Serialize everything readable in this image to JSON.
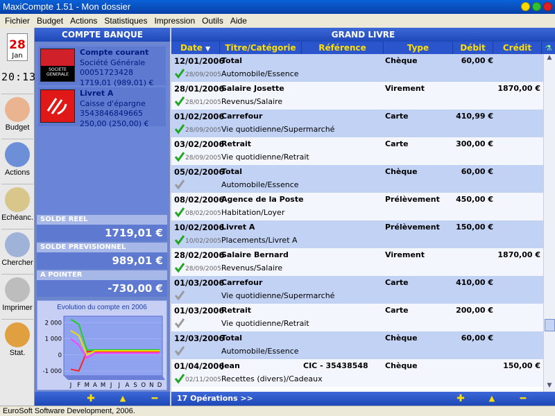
{
  "window": {
    "title": "MaxiCompte 1.51 - Mon dossier"
  },
  "menu": [
    "Fichier",
    "Budget",
    "Actions",
    "Statistiques",
    "Impression",
    "Outils",
    "Aide"
  ],
  "calendar": {
    "day": "28",
    "month": "Jan",
    "time": "20:13"
  },
  "tools": [
    {
      "label": "Budget",
      "icon": "piggy-bank-icon",
      "color": "#e9b48f"
    },
    {
      "label": "Actions",
      "icon": "gears-icon",
      "color": "#6d8fd8"
    },
    {
      "label": "Echéanc.",
      "icon": "clock-icon",
      "color": "#d9c68a"
    },
    {
      "label": "Chercher",
      "icon": "magnifier-icon",
      "color": "#9fb3d8"
    },
    {
      "label": "Imprimer",
      "icon": "printer-icon",
      "color": "#bdbdbd"
    },
    {
      "label": "Stat.",
      "icon": "pie-chart-icon",
      "color": "#e0a040"
    }
  ],
  "left_panel": {
    "title": "COMPTE BANQUE",
    "accounts": [
      {
        "name": "Compte courant",
        "bank": "Société Générale",
        "number": "00051723428",
        "balance": "1719,01 (989,01) €",
        "logo_text": "SOCIETE GENERALE",
        "logo_color": "#d0202a"
      },
      {
        "name": "Livret A",
        "bank": "Caisse d'épargne",
        "number": "3543846849665",
        "balance": "250,00 (250,00) €",
        "logo_text": "",
        "logo_color": "#e01818"
      }
    ],
    "solde_reel_label": "SOLDE REEL",
    "solde_reel": "1719,01 €",
    "solde_prev_label": "SOLDE PREVISIONNEL",
    "solde_prev": "989,01 €",
    "pointer_label": "A POINTER",
    "pointer": "-730,00 €"
  },
  "chart_data": {
    "type": "line",
    "title": "Evolution du compte en 2006",
    "categories": [
      "J",
      "F",
      "M",
      "A",
      "M",
      "J",
      "J",
      "A",
      "S",
      "O",
      "N",
      "D"
    ],
    "yticks": [
      "2 000",
      "1 000",
      "0",
      "-1 000"
    ],
    "ylim": [
      -1300,
      2400
    ],
    "series": [
      {
        "color": "#20d020",
        "values": [
          2200,
          1900,
          300,
          300,
          300,
          300,
          300,
          300,
          300,
          300,
          300,
          300
        ]
      },
      {
        "color": "#ff2020",
        "values": [
          -900,
          -1000,
          200,
          200,
          200,
          200,
          200,
          200,
          200,
          200,
          200,
          200
        ]
      },
      {
        "color": "#ff40ff",
        "values": [
          1000,
          600,
          -200,
          100,
          100,
          100,
          100,
          100,
          100,
          100,
          100,
          100
        ]
      },
      {
        "color": "#f0e000",
        "values": [
          1500,
          1200,
          0,
          250,
          250,
          250,
          250,
          250,
          250,
          250,
          250,
          250
        ]
      }
    ]
  },
  "ledger": {
    "title": "GRAND LIVRE",
    "columns": [
      "Date",
      "Titre/Catégorie",
      "Référence",
      "Type",
      "Débit",
      "Crédit"
    ],
    "rows": [
      {
        "date": "12/01/2006",
        "title": "Total",
        "cat": "Automobile/Essence",
        "ref": "",
        "type": "Chèque",
        "debit": "60,00 €",
        "credit": "",
        "pdate": "28/09/2005",
        "checked": true
      },
      {
        "date": "28/01/2006",
        "title": "Salaire Josette",
        "cat": "Revenus/Salaire",
        "ref": "",
        "type": "Virement",
        "debit": "",
        "credit": "1870,00 €",
        "pdate": "28/01/2005",
        "checked": true
      },
      {
        "date": "01/02/2006",
        "title": "Carrefour",
        "cat": "Vie quotidienne/Supermarché",
        "ref": "",
        "type": "Carte",
        "debit": "410,99 €",
        "credit": "",
        "pdate": "28/09/2005",
        "checked": true
      },
      {
        "date": "03/02/2006",
        "title": "Retrait",
        "cat": "Vie quotidienne/Retrait",
        "ref": "",
        "type": "Carte",
        "debit": "300,00 €",
        "credit": "",
        "pdate": "28/09/2005",
        "checked": true
      },
      {
        "date": "05/02/2006",
        "title": "Total",
        "cat": "Automobile/Essence",
        "ref": "",
        "type": "Chèque",
        "debit": "60,00 €",
        "credit": "",
        "pdate": "",
        "checked": false
      },
      {
        "date": "08/02/2006",
        "title": "Agence de la Poste",
        "cat": "Habitation/Loyer",
        "ref": "",
        "type": "Prélèvement",
        "debit": "450,00 €",
        "credit": "",
        "pdate": "08/02/2005",
        "checked": true
      },
      {
        "date": "10/02/2006",
        "title": "Livret A",
        "cat": "Placements/Livret A",
        "ref": "",
        "type": "Prélèvement",
        "debit": "150,00 €",
        "credit": "",
        "pdate": "10/02/2005",
        "checked": true
      },
      {
        "date": "28/02/2006",
        "title": "Salaire Bernard",
        "cat": "Revenus/Salaire",
        "ref": "",
        "type": "Virement",
        "debit": "",
        "credit": "1870,00 €",
        "pdate": "28/09/2005",
        "checked": true
      },
      {
        "date": "01/03/2006",
        "title": "Carrefour",
        "cat": "Vie quotidienne/Supermarché",
        "ref": "",
        "type": "Carte",
        "debit": "410,00 €",
        "credit": "",
        "pdate": "",
        "checked": false
      },
      {
        "date": "01/03/2006",
        "title": "Retrait",
        "cat": "Vie quotidienne/Retrait",
        "ref": "",
        "type": "Carte",
        "debit": "200,00 €",
        "credit": "",
        "pdate": "",
        "checked": false
      },
      {
        "date": "12/03/2006",
        "title": "Total",
        "cat": "Automobile/Essence",
        "ref": "",
        "type": "Chèque",
        "debit": "60,00 €",
        "credit": "",
        "pdate": "",
        "checked": false
      },
      {
        "date": "01/04/2006",
        "title": "Jean",
        "cat": "Recettes (divers)/Cadeaux",
        "ref": "CIC - 35438548",
        "type": "Chèque",
        "debit": "",
        "credit": "150,00 €",
        "pdate": "02/11/2005",
        "checked": true
      }
    ],
    "ops": "17 Opérations >>"
  },
  "status": "EuroSoft Software Development, 2006."
}
